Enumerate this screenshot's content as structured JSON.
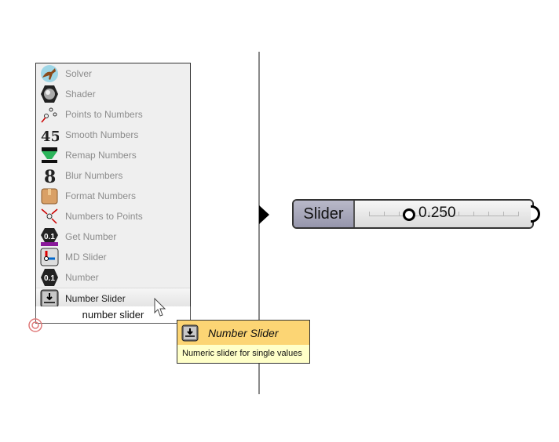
{
  "search_popup": {
    "items": [
      {
        "label": "Solver",
        "icon": "kangaroo-icon"
      },
      {
        "label": "Shader",
        "icon": "shader-sphere-icon"
      },
      {
        "label": "Points to Numbers",
        "icon": "points-to-numbers-icon"
      },
      {
        "label": "Smooth Numbers",
        "icon": "smooth-numbers-icon"
      },
      {
        "label": "Remap Numbers",
        "icon": "remap-numbers-icon"
      },
      {
        "label": "Blur Numbers",
        "icon": "blur-numbers-icon"
      },
      {
        "label": "Format Numbers",
        "icon": "format-numbers-icon"
      },
      {
        "label": "Numbers to Points",
        "icon": "numbers-to-points-icon"
      },
      {
        "label": "Get Number",
        "icon": "get-number-icon"
      },
      {
        "label": "MD Slider",
        "icon": "md-slider-icon"
      },
      {
        "label": "Number",
        "icon": "number-icon"
      },
      {
        "label": "Number Slider",
        "icon": "number-slider-icon",
        "selected": true
      }
    ],
    "query": "number slider"
  },
  "tooltip": {
    "title": "Number Slider",
    "description": "Numeric slider for single values"
  },
  "slider_component": {
    "name": "Slider",
    "value": "0.250",
    "value_fraction": 0.25
  },
  "colors": {
    "tooltip_header": "#fcd574",
    "tooltip_body": "#ffffc8",
    "slider_name_bg": "#a7a7bb"
  }
}
